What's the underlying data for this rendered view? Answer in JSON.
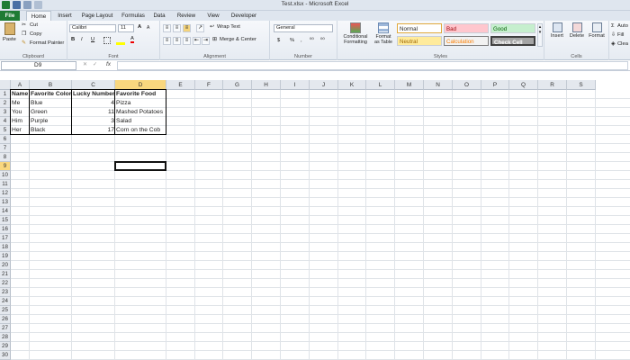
{
  "window": {
    "title": "Test.xlsx - Microsoft Excel"
  },
  "tabs": [
    {
      "label": "File"
    },
    {
      "label": "Home"
    },
    {
      "label": "Insert"
    },
    {
      "label": "Page Layout"
    },
    {
      "label": "Formulas"
    },
    {
      "label": "Data"
    },
    {
      "label": "Review"
    },
    {
      "label": "View"
    },
    {
      "label": "Developer"
    }
  ],
  "ribbon": {
    "clipboard": {
      "paste": "Paste",
      "cut": "Cut",
      "copy": "Copy",
      "format_painter": "Format Painter",
      "label": "Clipboard"
    },
    "font": {
      "name": "Calibri",
      "size": "11",
      "bold": "B",
      "italic": "I",
      "underline": "U",
      "grow": "A",
      "shrink": "A",
      "font_color": "A",
      "label": "Font"
    },
    "alignment": {
      "wrap_text": "Wrap Text",
      "merge_center": "Merge & Center",
      "label": "Alignment"
    },
    "number": {
      "format": "General",
      "currency": "$",
      "percent": "%",
      "comma": ",",
      "label": "Number"
    },
    "styles": {
      "conditional": "Conditional Formatting",
      "format_as_table": "Format as Table",
      "normal": "Normal",
      "bad": "Bad",
      "good": "Good",
      "neutral": "Neutral",
      "calculation": "Calculation",
      "check_cell": "Check Cell",
      "label": "Styles"
    },
    "cells": {
      "insert": "Insert",
      "delete": "Delete",
      "format": "Format",
      "label": "Cells"
    },
    "editing": {
      "autosum": "Auto",
      "fill": "Fill",
      "clear": "Clea"
    }
  },
  "formula_bar": {
    "name_box": "D9",
    "fx": "fx",
    "value": ""
  },
  "columns": [
    "A",
    "B",
    "C",
    "D",
    "E",
    "F",
    "G",
    "H",
    "I",
    "J",
    "K",
    "L",
    "M",
    "N",
    "O",
    "P",
    "Q",
    "R",
    "S"
  ],
  "rows": [
    "1",
    "2",
    "3",
    "4",
    "5",
    "6",
    "7",
    "8",
    "9",
    "10",
    "11",
    "12",
    "13",
    "14",
    "15",
    "16",
    "17",
    "18",
    "19",
    "20",
    "21",
    "22",
    "23",
    "24",
    "25",
    "26",
    "27",
    "28",
    "29",
    "30"
  ],
  "table": {
    "headers": [
      "Name",
      "Favorite Color",
      "Lucky Number",
      "Favorite Food"
    ],
    "rows": [
      [
        "Me",
        "Blue",
        "4",
        "Pizza"
      ],
      [
        "You",
        "Green",
        "11",
        "Mashed Potatoes"
      ],
      [
        "Him",
        "Purple",
        "3",
        "Salad"
      ],
      [
        "Her",
        "Black",
        "17",
        "Corn on the Cob"
      ]
    ]
  },
  "selection": {
    "cell": "D9"
  },
  "colors": {
    "file_tab": "#1e7b34",
    "selected_header": "#f9d77e",
    "bad_fill": "#ffc7ce",
    "good_fill": "#c6efce",
    "neutral_fill": "#ffeb9c"
  }
}
